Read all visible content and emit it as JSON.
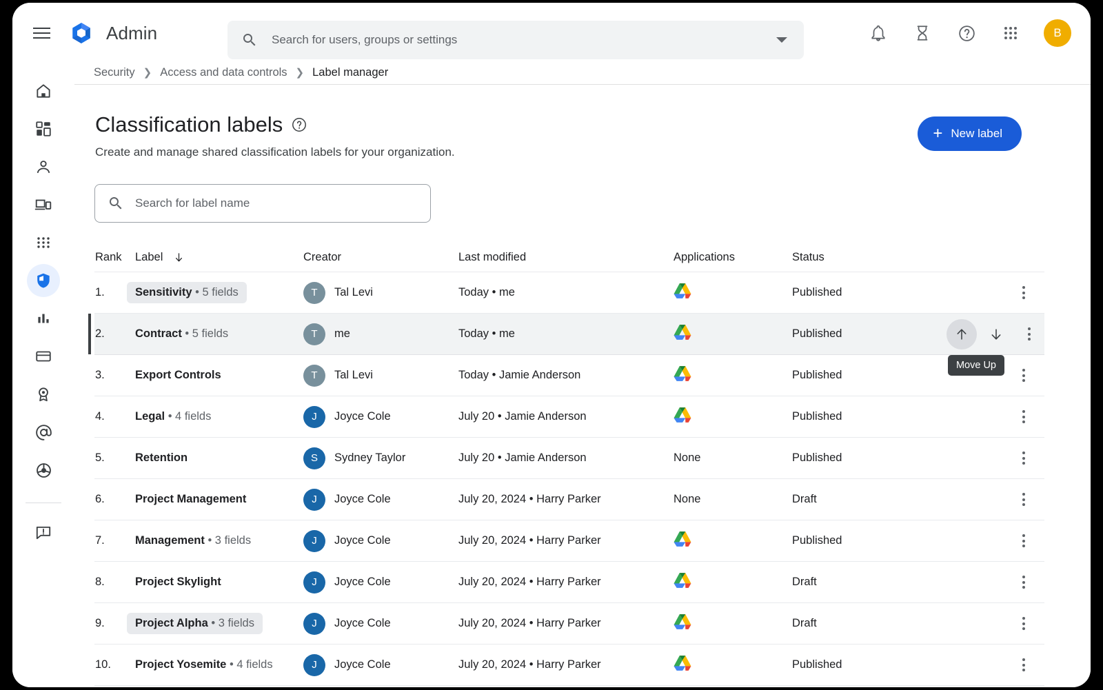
{
  "app": {
    "title": "Admin",
    "logo_icon": "google-admin-logo",
    "menu_icon": "hamburger-menu-icon",
    "avatar_initial": "B",
    "avatar_color": "#f0ad00"
  },
  "search": {
    "icon": "search-icon",
    "placeholder": "Search for users, groups or settings",
    "value": "",
    "caret_icon": "chevron-down-icon"
  },
  "top_icons": [
    {
      "name": "notifications-bell-icon",
      "glyph": "bell"
    },
    {
      "name": "hourglass-icon",
      "glyph": "hourglass"
    },
    {
      "name": "help-icon",
      "glyph": "question-circle"
    },
    {
      "name": "apps-grid-icon",
      "glyph": "grid"
    }
  ],
  "breadcrumb": [
    {
      "label": "Security",
      "current": false
    },
    {
      "label": "Access and data controls",
      "current": false
    },
    {
      "label": "Label manager",
      "current": true
    }
  ],
  "sidebar": {
    "items": [
      {
        "name": "sidebar-item-home",
        "icon": "home-icon",
        "active": false
      },
      {
        "name": "sidebar-item-dashboard",
        "icon": "dashboard-icon",
        "active": false
      },
      {
        "name": "sidebar-item-directory",
        "icon": "person-icon",
        "active": false
      },
      {
        "name": "sidebar-item-devices",
        "icon": "devices-icon",
        "active": false
      },
      {
        "name": "sidebar-item-apps",
        "icon": "apps-grid-icon",
        "active": false
      },
      {
        "name": "sidebar-item-security",
        "icon": "shield-icon",
        "active": true
      },
      {
        "name": "sidebar-item-reporting",
        "icon": "bar-chart-icon",
        "active": false
      },
      {
        "name": "sidebar-item-billing",
        "icon": "credit-card-icon",
        "active": false
      },
      {
        "name": "sidebar-item-account",
        "icon": "badge-icon",
        "active": false
      },
      {
        "name": "sidebar-item-rules",
        "icon": "at-sign-icon",
        "active": false
      },
      {
        "name": "sidebar-item-directory-sync",
        "icon": "steering-wheel-icon",
        "active": false
      }
    ],
    "footer_items": [
      {
        "name": "sidebar-item-send-feedback",
        "icon": "feedback-icon",
        "active": false
      }
    ]
  },
  "page": {
    "title": "Classification labels",
    "title_help_icon": "help-circle-icon",
    "subtitle": "Create and manage shared classification labels for your organization.",
    "new_label_button": "New label",
    "new_label_plus": "+",
    "accent_color": "#1a5cd8"
  },
  "label_search": {
    "icon": "search-icon",
    "placeholder": "Search for label name",
    "value": ""
  },
  "table": {
    "columns": [
      {
        "key": "rank",
        "header": "Rank"
      },
      {
        "key": "label",
        "header": "Label",
        "sorted": true,
        "sort_icon": "arrow-down-icon"
      },
      {
        "key": "creator",
        "header": "Creator"
      },
      {
        "key": "modified",
        "header": "Last modified"
      },
      {
        "key": "applications",
        "header": "Applications"
      },
      {
        "key": "status",
        "header": "Status"
      }
    ],
    "rows": [
      {
        "rank": "1.",
        "label": "Sensitivity",
        "fields": "5 fields",
        "highlight": true,
        "creator": "Tal Levi",
        "avatar_initial": "T",
        "avatar_class": "av-t",
        "modified": "Today • me",
        "applications": "drive",
        "apps_text": "",
        "status": "Published",
        "selected": false
      },
      {
        "rank": "2.",
        "label": "Contract",
        "fields": "5 fields",
        "highlight": false,
        "creator": "me",
        "avatar_initial": "T",
        "avatar_class": "av-t",
        "modified": "Today • me",
        "applications": "drive",
        "apps_text": "",
        "status": "Published",
        "selected": true
      },
      {
        "rank": "3.",
        "label": "Export Controls",
        "fields": "",
        "highlight": false,
        "creator": "Tal Levi",
        "avatar_initial": "T",
        "avatar_class": "av-t",
        "modified": "Today • Jamie Anderson",
        "applications": "drive",
        "apps_text": "",
        "status": "Published",
        "selected": false
      },
      {
        "rank": "4.",
        "label": "Legal",
        "fields": "4 fields",
        "highlight": false,
        "creator": "Joyce Cole",
        "avatar_initial": "J",
        "avatar_class": "av-j",
        "modified": "July 20 • Jamie Anderson",
        "applications": "drive",
        "apps_text": "",
        "status": "Published",
        "selected": false
      },
      {
        "rank": "5.",
        "label": "Retention",
        "fields": "",
        "highlight": false,
        "creator": "Sydney Taylor",
        "avatar_initial": "S",
        "avatar_class": "av-s",
        "modified": "July 20 • Jamie Anderson",
        "applications": "none",
        "apps_text": "None",
        "status": "Published",
        "selected": false
      },
      {
        "rank": "6.",
        "label": "Project Management",
        "fields": "",
        "highlight": false,
        "creator": "Joyce Cole",
        "avatar_initial": "J",
        "avatar_class": "av-j",
        "modified": "July 20, 2024 • Harry Parker",
        "applications": "none",
        "apps_text": "None",
        "status": "Draft",
        "selected": false
      },
      {
        "rank": "7.",
        "label": "Management",
        "fields": "3 fields",
        "highlight": false,
        "creator": "Joyce Cole",
        "avatar_initial": "J",
        "avatar_class": "av-j",
        "modified": "July 20, 2024 • Harry Parker",
        "applications": "drive",
        "apps_text": "",
        "status": "Published",
        "selected": false
      },
      {
        "rank": "8.",
        "label": "Project Skylight",
        "fields": "",
        "highlight": false,
        "creator": "Joyce Cole",
        "avatar_initial": "J",
        "avatar_class": "av-j",
        "modified": "July 20, 2024 • Harry Parker",
        "applications": "drive",
        "apps_text": "",
        "status": "Draft",
        "selected": false
      },
      {
        "rank": "9.",
        "label": "Project Alpha",
        "fields": "3 fields",
        "highlight": true,
        "creator": "Joyce Cole",
        "avatar_initial": "J",
        "avatar_class": "av-j",
        "modified": "July 20, 2024 • Harry Parker",
        "applications": "drive",
        "apps_text": "",
        "status": "Draft",
        "selected": false
      },
      {
        "rank": "10.",
        "label": "Project Yosemite",
        "fields": "4 fields",
        "highlight": false,
        "creator": "Joyce Cole",
        "avatar_initial": "J",
        "avatar_class": "av-j",
        "modified": "July 20, 2024 • Harry Parker",
        "applications": "drive",
        "apps_text": "",
        "status": "Published",
        "selected": false
      }
    ],
    "row_actions": {
      "move_up_icon": "arrow-up-icon",
      "move_down_icon": "arrow-down-icon",
      "overflow_icon": "more-vert-icon"
    },
    "tooltip": "Move Up"
  }
}
